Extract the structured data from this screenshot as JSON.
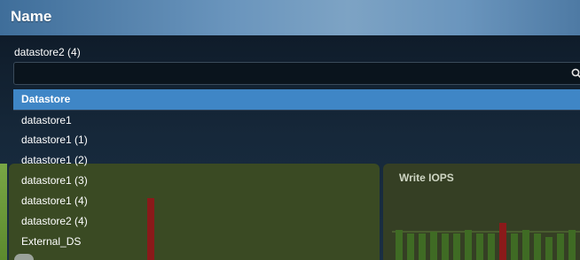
{
  "header": {
    "title": "Name"
  },
  "selector": {
    "selected_value": "datastore2 (4)",
    "search_placeholder": ""
  },
  "options": [
    "Datastore",
    "datastore1",
    "datastore1 (1)",
    "datastore1 (2)",
    "datastore1 (3)",
    "datastore1 (4)",
    "datastore2 (4)",
    "External_DS"
  ],
  "highlighted_option_index": 0,
  "panels": {
    "right_title": "Write IOPS"
  },
  "colors": {
    "header_blue": "#6a95bd",
    "highlight_blue": "#3f86c6",
    "panel_green": "#3a4a23",
    "bar_green": "#3f6b24",
    "bar_red": "#8b1a1a"
  }
}
